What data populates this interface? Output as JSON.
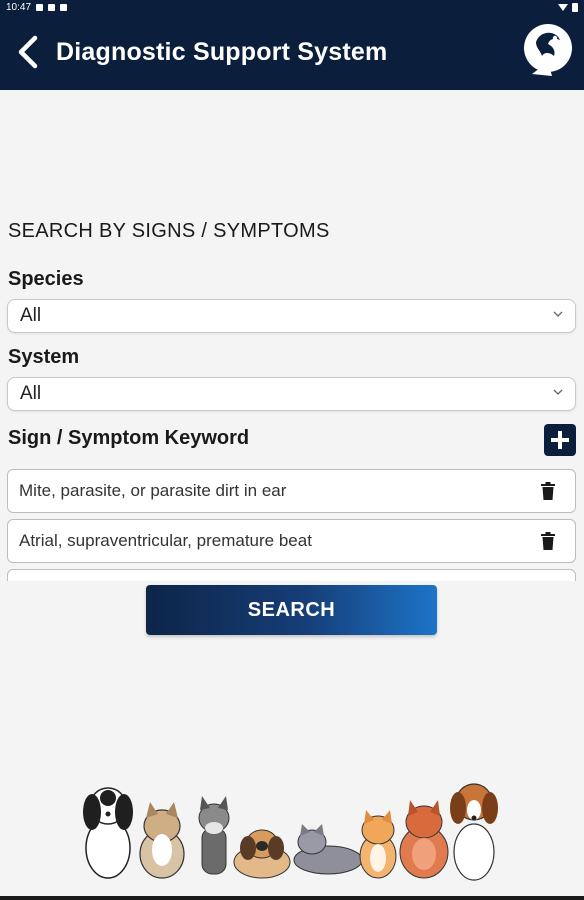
{
  "status_bar": {
    "time": "10:47",
    "left_icons": [
      "notification-icon",
      "notification-icon",
      "notification-icon"
    ],
    "right_icons": [
      "wifi-icon",
      "battery-icon"
    ]
  },
  "app_bar": {
    "back_icon": "back-arrow-icon",
    "title": "Diagnostic Support System",
    "logo_icon": "app-logo-icon",
    "background": "#0b1f3d"
  },
  "form": {
    "section_title": "SEARCH BY SIGNS / SYMPTOMS",
    "species": {
      "label": "Species",
      "value": "All"
    },
    "system": {
      "label": "System",
      "value": "All"
    },
    "keyword": {
      "label": "Sign / Symptom Keyword",
      "add_icon": "plus-icon",
      "items": [
        {
          "text": "Mite, parasite, or parasite dirt in ear"
        },
        {
          "text": "Atrial, supraventricular, premature beat"
        }
      ]
    },
    "search_button": "SEARCH"
  },
  "illustration": {
    "name": "cats-and-dogs-illustration"
  },
  "colors": {
    "primary": "#0b1f3d",
    "accent": "#1d74c8",
    "background": "#f4f4f4"
  }
}
